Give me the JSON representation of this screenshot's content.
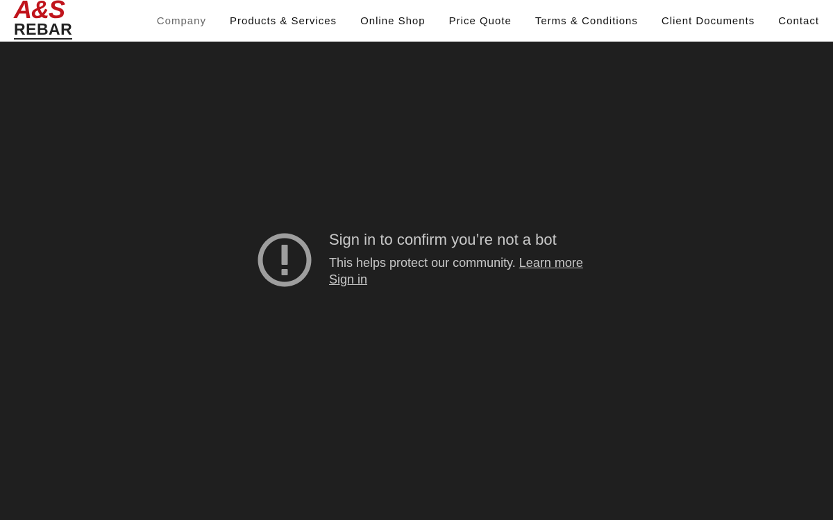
{
  "logo": {
    "line1": "A&S",
    "line2": "REBAR",
    "line1_color": "#c0141c",
    "line2_color": "#222222"
  },
  "nav": {
    "items": [
      {
        "label": "Company"
      },
      {
        "label": "Products & Services"
      },
      {
        "label": "Online Shop"
      },
      {
        "label": "Price Quote"
      },
      {
        "label": "Terms & Conditions"
      },
      {
        "label": "Client Documents"
      },
      {
        "label": "Contact"
      }
    ],
    "active_index": 0
  },
  "notice": {
    "icon": "alert-circle-icon",
    "title": "Sign in to confirm you’re not a bot",
    "description": "This helps protect our community.",
    "learn_more": "Learn more",
    "sign_in": "Sign in"
  },
  "colors": {
    "background": "#1f1f1f",
    "header": "#ffffff",
    "text": "#c8c8c8",
    "icon": "#9e9e9e"
  }
}
